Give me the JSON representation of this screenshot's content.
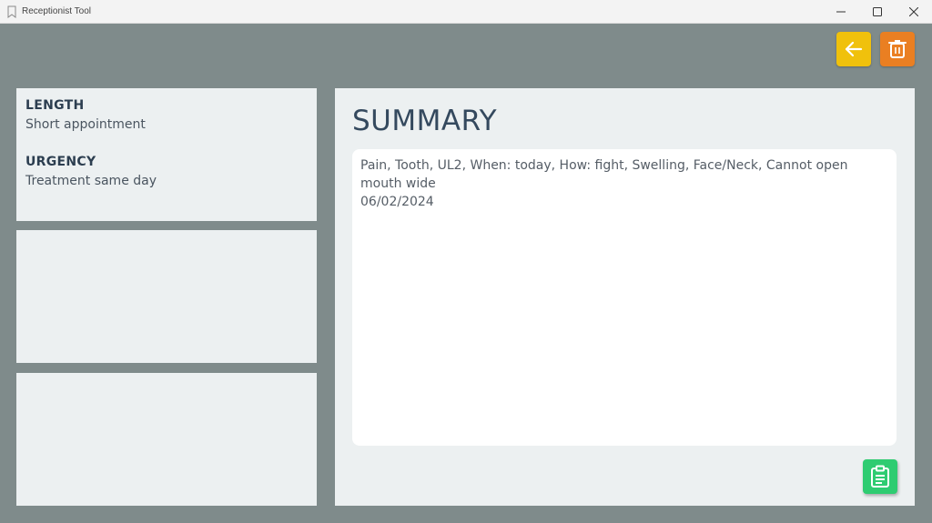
{
  "window": {
    "title": "Receptionist Tool",
    "controls": {
      "minimize_icon": "minimize-icon",
      "maximize_icon": "maximize-icon",
      "close_icon": "close-icon"
    }
  },
  "toolbar": {
    "back_icon": "arrow-left-icon",
    "delete_icon": "trash-icon"
  },
  "details": {
    "length_label": "LENGTH",
    "length_value": "Short appointment",
    "urgency_label": "URGENCY",
    "urgency_value": "Treatment same day"
  },
  "summary": {
    "title": "SUMMARY",
    "text": "Pain, Tooth, UL2, When: today, How: fight, Swelling, Face/Neck, Cannot open mouth wide",
    "date": "06/02/2024",
    "copy_icon": "clipboard-icon"
  },
  "colors": {
    "background": "#7f8b8b",
    "panel": "#ecf0f1",
    "back_button": "#f0c10c",
    "delete_button": "#ea7f22",
    "copy_button": "#2ecc71",
    "heading": "#34495e"
  }
}
